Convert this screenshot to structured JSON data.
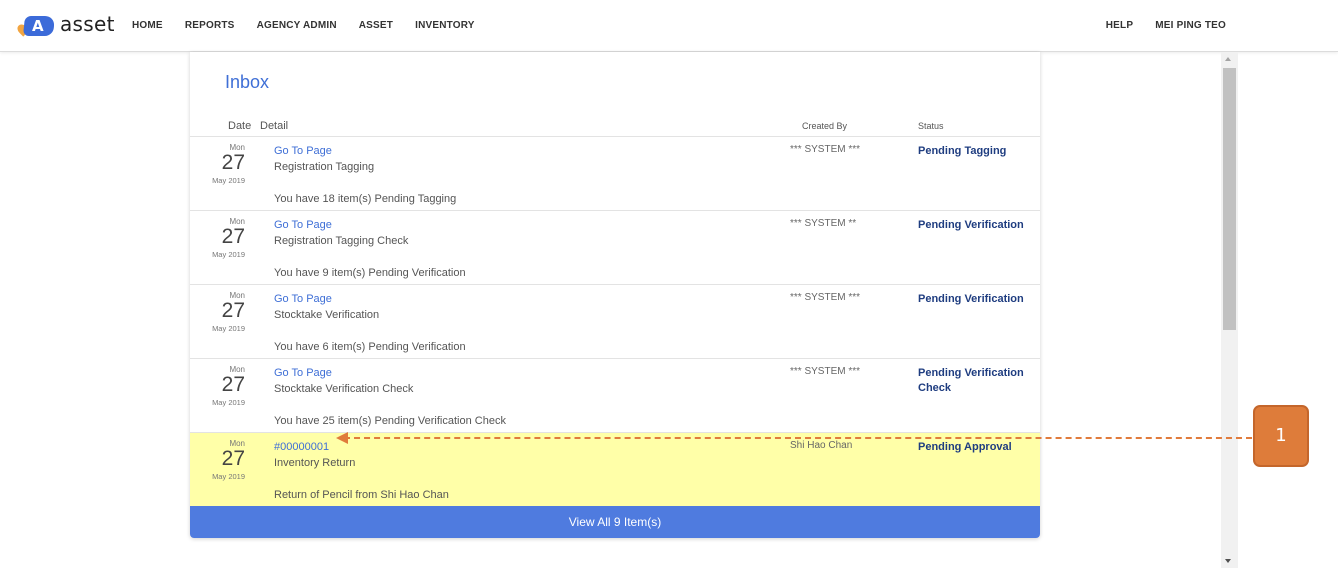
{
  "app": {
    "logo_letter": "A",
    "logo_text": "asset"
  },
  "nav": {
    "left": [
      "HOME",
      "REPORTS",
      "AGENCY ADMIN",
      "ASSET",
      "INVENTORY"
    ],
    "right": [
      "HELP",
      "MEI PING TEO"
    ]
  },
  "inbox": {
    "title": "Inbox",
    "columns": {
      "date": "Date",
      "detail": "Detail",
      "created_by": "Created By",
      "status": "Status"
    },
    "rows": [
      {
        "weekday": "Mon",
        "day": "27",
        "month_year": "May 2019",
        "link": "Go To Page",
        "title": "Registration Tagging",
        "description": "You have 18 item(s) Pending Tagging",
        "created_by": "*** SYSTEM ***",
        "status": "Pending Tagging"
      },
      {
        "weekday": "Mon",
        "day": "27",
        "month_year": "May 2019",
        "link": "Go To Page",
        "title": "Registration Tagging Check",
        "description": "You have 9 item(s) Pending Verification",
        "created_by": "*** SYSTEM **",
        "status": "Pending Verification"
      },
      {
        "weekday": "Mon",
        "day": "27",
        "month_year": "May 2019",
        "link": "Go To Page",
        "title": "Stocktake Verification",
        "description": "You have 6 item(s) Pending Verification",
        "created_by": "*** SYSTEM ***",
        "status": "Pending Verification"
      },
      {
        "weekday": "Mon",
        "day": "27",
        "month_year": "May 2019",
        "link": "Go To Page",
        "title": "Stocktake Verification Check",
        "description": "You have 25 item(s) Pending Verification Check",
        "created_by": "*** SYSTEM ***",
        "status": "Pending Verification Check"
      },
      {
        "weekday": "Mon",
        "day": "27",
        "month_year": "May 2019",
        "link": "#00000001",
        "title": "Inventory Return",
        "description": "Return of Pencil from Shi Hao Chan",
        "created_by": "Shi Hao Chan",
        "status": "Pending Approval",
        "highlighted": true
      }
    ],
    "view_all": "View All 9 Item(s)"
  },
  "callout": {
    "label": "1"
  },
  "colors": {
    "accent": "#3f6fd6",
    "status": "#1f3d80",
    "highlight": "#ffffa8",
    "button": "#4f7bdf",
    "callout": "#de7c3a"
  }
}
